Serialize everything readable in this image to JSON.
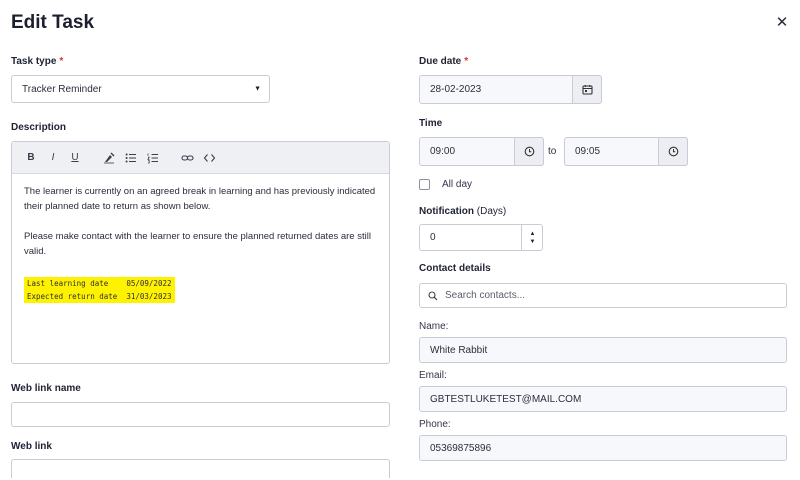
{
  "dialog": {
    "title": "Edit Task",
    "close_icon": "close-icon"
  },
  "task_type": {
    "label": "Task type",
    "required_mark": "*",
    "value": "Tracker Reminder"
  },
  "description": {
    "label": "Description",
    "toolbar": {
      "bold": "B",
      "italic": "I",
      "underline": "U"
    },
    "paragraph_1": "The learner is currently on an agreed break in learning and has previously indicated their planned date to return as shown below.",
    "paragraph_2": "Please make contact with the learner to ensure the planned returned dates are still valid.",
    "line_1": "Last learning date    05/09/2022",
    "line_2": "Expected return date  31/03/2023",
    "highlight_color": "#fff200"
  },
  "web_link_name": {
    "label": "Web link name",
    "value": ""
  },
  "web_link": {
    "label": "Web link",
    "value": ""
  },
  "due_date": {
    "label": "Due date",
    "required_mark": "*",
    "value": "28-02-2023"
  },
  "time": {
    "label": "Time",
    "start": "09:00",
    "separator": "to",
    "end": "09:05"
  },
  "all_day": {
    "label": "All day",
    "checked": false
  },
  "notification": {
    "label": "Notification",
    "unit": "(Days)",
    "value": "0"
  },
  "contact": {
    "label": "Contact details",
    "search_placeholder": "Search contacts...",
    "name_label": "Name:",
    "name_value": "White Rabbit",
    "email_label": "Email:",
    "email_value": "GBTESTLUKETEST@MAIL.COM",
    "phone_label": "Phone:",
    "phone_value": "05369875896"
  }
}
